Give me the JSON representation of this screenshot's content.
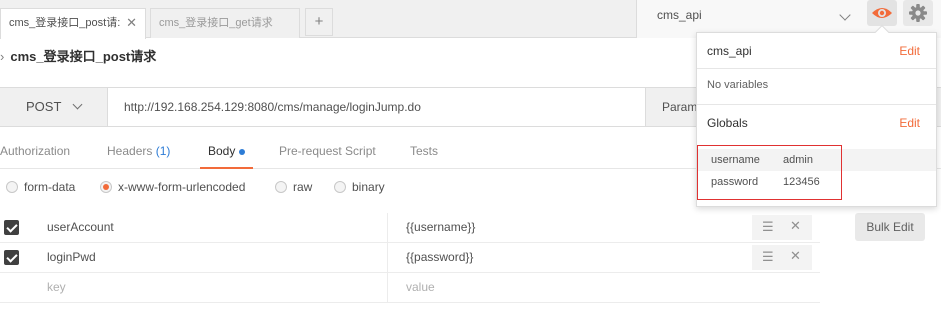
{
  "tabs": [
    {
      "label": "cms_登录接口_post请:",
      "close": "✕",
      "active": true
    },
    {
      "label": "cms_登录接口_get请求",
      "active": false
    }
  ],
  "tab_add": "+",
  "environment": {
    "selected": "cms_api",
    "eye_icon": "eye-icon",
    "gear_icon": "gear-icon"
  },
  "request": {
    "name": "cms_登录接口_post请求",
    "method": "POST",
    "url": "http://192.168.254.129:8080/cms/manage/loginJump.do",
    "params_label": "Param"
  },
  "subtabs": {
    "authorization": "Authorization",
    "headers": "Headers",
    "headers_count": "(1)",
    "body": "Body",
    "prerequest": "Pre-request Script",
    "tests": "Tests"
  },
  "body_modes": [
    {
      "label": "form-data",
      "selected": false
    },
    {
      "label": "x-www-form-urlencoded",
      "selected": true
    },
    {
      "label": "raw",
      "selected": false
    },
    {
      "label": "binary",
      "selected": false
    }
  ],
  "kv_rows": [
    {
      "key": "userAccount",
      "value": "{{username}}",
      "checked": true
    },
    {
      "key": "loginPwd",
      "value": "{{password}}",
      "checked": true
    }
  ],
  "kv_placeholder": {
    "key": "key",
    "value": "value"
  },
  "bulk_edit": "Bulk Edit",
  "popover": {
    "env_title": "cms_api",
    "edit_label": "Edit",
    "no_variables": "No variables",
    "globals_title": "Globals",
    "globals": [
      {
        "name": "username",
        "value": "admin"
      },
      {
        "name": "password",
        "value": "123456"
      }
    ]
  },
  "colors": {
    "accent": "#f26b3a",
    "link_blue": "#2d7cd6",
    "highlight_red": "#e03131"
  }
}
